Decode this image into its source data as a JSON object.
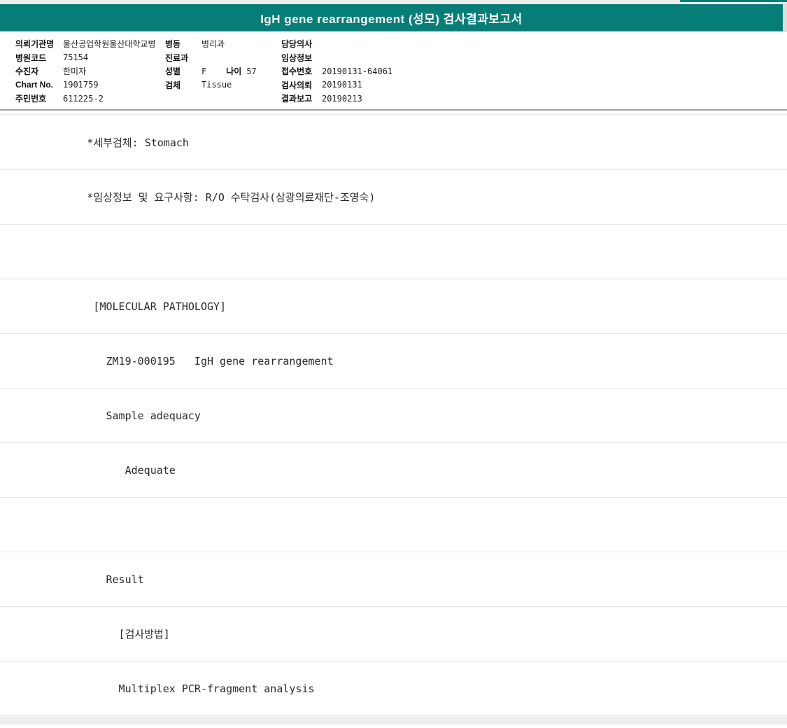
{
  "title_bar": {
    "title": "IgH gene rearrangement (성모) 검사결과보고서"
  },
  "patient_info": {
    "col1": [
      {
        "label": "의뢰기관명",
        "value": "울산공업학원울산대학교병"
      },
      {
        "label": "병원코드",
        "value": "75154"
      },
      {
        "label": "수진자",
        "value": "한미자"
      },
      {
        "label": "Chart No.",
        "value": "1901759"
      },
      {
        "label": "주민번호",
        "value": "611225-2"
      }
    ],
    "col2": [
      {
        "label": "병동",
        "value": "병리과"
      },
      {
        "label": "진료과",
        "value": ""
      },
      {
        "label": "성별",
        "value": "F",
        "label2": "나이",
        "value2": "57"
      },
      {
        "label": "검체",
        "value": "Tissue"
      },
      {
        "label": "",
        "value": ""
      }
    ],
    "col3": [
      {
        "label": "담당의사",
        "value": ""
      },
      {
        "label": "임상정보",
        "value": ""
      },
      {
        "label": "접수번호",
        "value": "20190131-64061"
      },
      {
        "label": "검사의뢰",
        "value": "20190131"
      },
      {
        "label": "결과보고",
        "value": "20190213"
      }
    ]
  },
  "report_lines": [
    "             *세부검체: Stomach",
    "             *임상정보 및 요구사항: R/O 수탁검사(삼광의료재단-조영숙)",
    "",
    "              [MOLECULAR PATHOLOGY]",
    "                ZM19-000195   IgH gene rearrangement",
    "                Sample adequacy",
    "                   Adequate",
    "",
    "                Result",
    "                  [검사방법]",
    "                  Multiplex PCR-fragment analysis"
  ],
  "colors": {
    "accent_teal": "#077d77",
    "separator_light": "#e6e6e6",
    "separator_dark": "#a3a3a3"
  }
}
